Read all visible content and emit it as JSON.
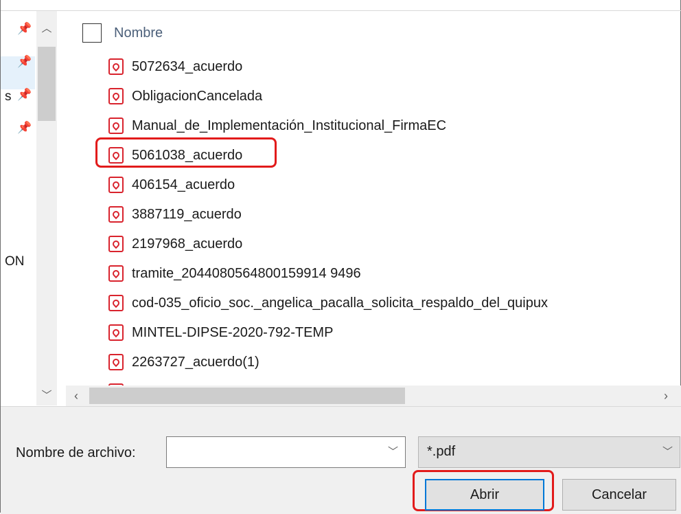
{
  "nav": {
    "fragment_1": "s",
    "fragment_2": "ON"
  },
  "list": {
    "column_header": "Nombre",
    "files": [
      "5072634_acuerdo",
      "ObligacionCancelada",
      "Manual_de_Implementación_Institucional_FirmaEC",
      "5061038_acuerdo",
      "406154_acuerdo",
      "3887119_acuerdo",
      "2197968_acuerdo",
      "tramite_2044080564800159914 9496",
      "cod-035_oficio_soc._angelica_pacalla_solicita_respaldo_del_quipux",
      "MINTEL-DIPSE-2020-792-TEMP",
      "2263727_acuerdo(1)"
    ],
    "highlighted_file": "5061038_acuerdo"
  },
  "footer": {
    "filename_label": "Nombre de archivo:",
    "filename_value": "",
    "filetype_value": "*.pdf",
    "open_label": "Abrir",
    "cancel_label": "Cancelar"
  },
  "icons": {
    "file": "pdf-file-icon",
    "pin": "pin-icon"
  },
  "colors": {
    "highlight": "#e21b1b",
    "pdf_red": "#d9232d",
    "focus_blue": "#0078d7",
    "selection_bg": "#e5f1fb"
  }
}
